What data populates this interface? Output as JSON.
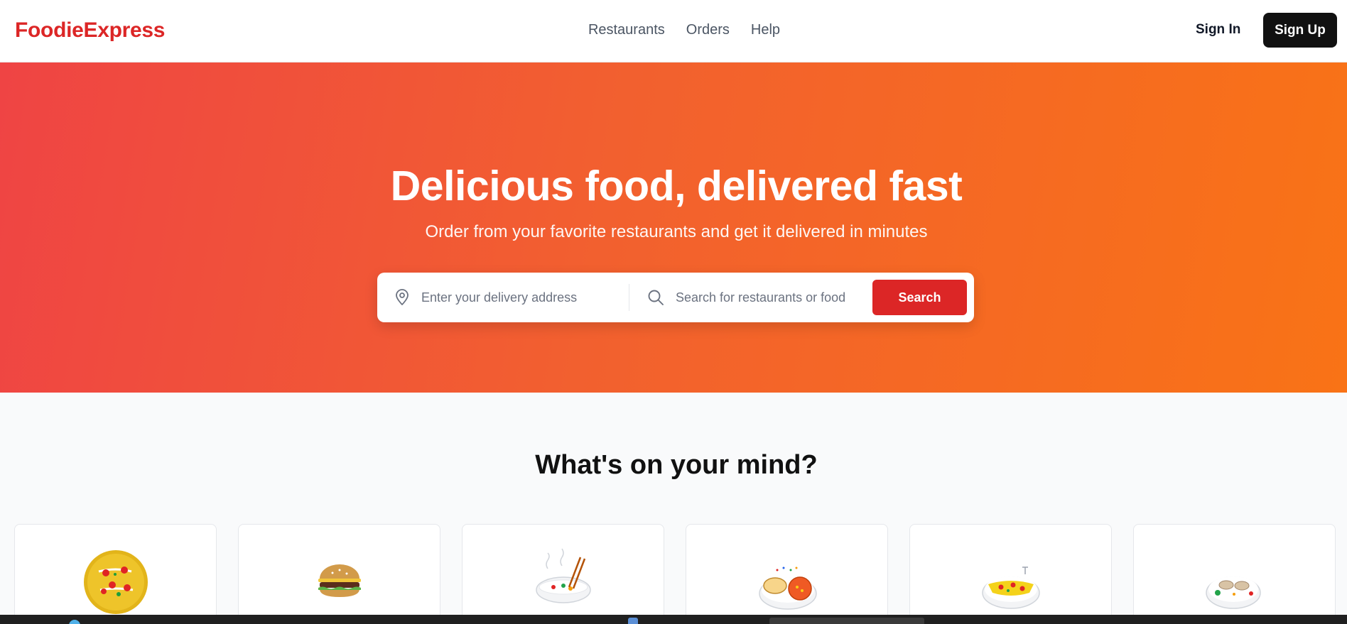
{
  "brand": {
    "name": "FoodieExpress",
    "color": "#dc2626"
  },
  "nav": {
    "links": [
      "Restaurants",
      "Orders",
      "Help"
    ],
    "sign_in": "Sign In",
    "sign_up": "Sign Up"
  },
  "hero": {
    "title": "Delicious food, delivered fast",
    "subtitle": "Order from your favorite restaurants and get it delivered in minutes",
    "address_placeholder": "Enter your delivery address",
    "search_placeholder": "Search for restaurants or food",
    "search_button": "Search",
    "gradient_start": "#ef4444",
    "gradient_end": "#f97316"
  },
  "categories": {
    "title": "What's on your mind?",
    "items": [
      {
        "icon": "pizza-icon"
      },
      {
        "icon": "burger-icon"
      },
      {
        "icon": "noodle-bowl-icon"
      },
      {
        "icon": "soup-plate-icon"
      },
      {
        "icon": "pasta-plate-icon"
      },
      {
        "icon": "dumpling-plate-icon"
      }
    ]
  },
  "icons": {
    "address": "map-pin-icon",
    "search": "search-icon"
  }
}
